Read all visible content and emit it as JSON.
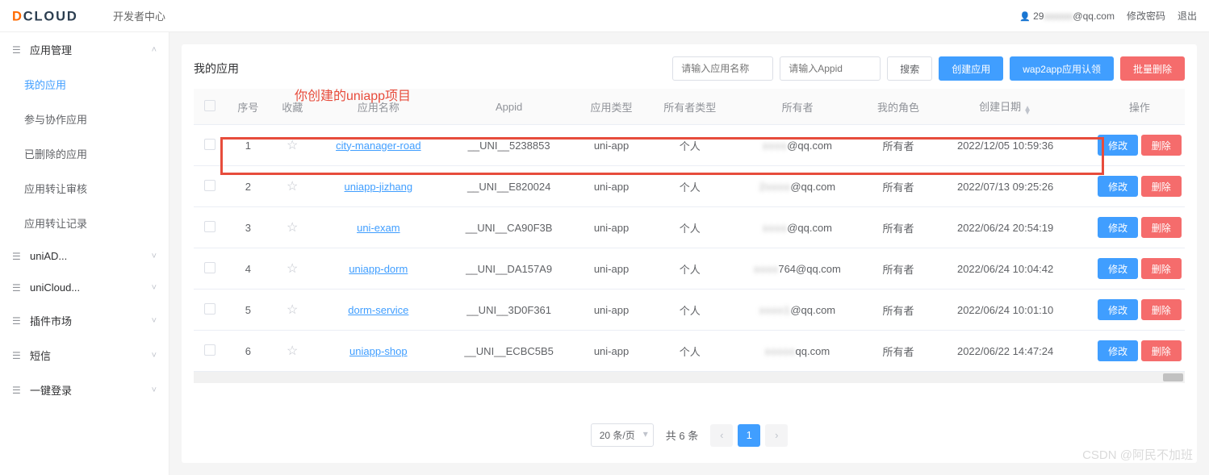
{
  "header": {
    "logo_text": "DCLOUD",
    "center_title": "开发者中心",
    "user_prefix": "29",
    "user_suffix": "@qq.com",
    "change_pwd": "修改密码",
    "logout": "退出"
  },
  "sidebar": {
    "groups": [
      {
        "label": "应用管理",
        "expanded": true,
        "items": [
          {
            "label": "我的应用",
            "active": true
          },
          {
            "label": "参与协作应用"
          },
          {
            "label": "已删除的应用"
          },
          {
            "label": "应用转让审核"
          },
          {
            "label": "应用转让记录"
          }
        ]
      },
      {
        "label": "uniAD..."
      },
      {
        "label": "uniCloud..."
      },
      {
        "label": "插件市场"
      },
      {
        "label": "短信"
      },
      {
        "label": "一键登录"
      }
    ]
  },
  "page": {
    "title": "我的应用",
    "annotation": "你创建的uniapp项目",
    "search_name_placeholder": "请输入应用名称",
    "search_appid_placeholder": "请输入Appid",
    "btn_search": "搜索",
    "btn_create": "创建应用",
    "btn_wap2app": "wap2app应用认领",
    "btn_batch_delete": "批量删除"
  },
  "table": {
    "headers": {
      "index": "序号",
      "fav": "收藏",
      "name": "应用名称",
      "appid": "Appid",
      "type": "应用类型",
      "owner_type": "所有者类型",
      "owner": "所有者",
      "role": "我的角色",
      "created": "创建日期",
      "ops": "操作"
    },
    "btn_edit": "修改",
    "btn_delete": "删除",
    "rows": [
      {
        "idx": "1",
        "name": "city-manager-road",
        "appid": "__UNI__5238853",
        "type": "uni-app",
        "owner_type": "个人",
        "owner_blur": "xxxx",
        "owner_suffix": "@qq.com",
        "role": "所有者",
        "created": "2022/12/05 10:59:36",
        "highlight": true
      },
      {
        "idx": "2",
        "name": "uniapp-jizhang",
        "appid": "__UNI__E820024",
        "type": "uni-app",
        "owner_type": "个人",
        "owner_blur": "2xxxx",
        "owner_suffix": "@qq.com",
        "role": "所有者",
        "created": "2022/07/13 09:25:26"
      },
      {
        "idx": "3",
        "name": "uni-exam",
        "appid": "__UNI__CA90F3B",
        "type": "uni-app",
        "owner_type": "个人",
        "owner_blur": "xxxx",
        "owner_suffix": "@qq.com",
        "role": "所有者",
        "created": "2022/06/24 20:54:19"
      },
      {
        "idx": "4",
        "name": "uniapp-dorm",
        "appid": "__UNI__DA157A9",
        "type": "uni-app",
        "owner_type": "个人",
        "owner_blur": "xxxx",
        "owner_suffix": "764@qq.com",
        "role": "所有者",
        "created": "2022/06/24 10:04:42"
      },
      {
        "idx": "5",
        "name": "dorm-service",
        "appid": "__UNI__3D0F361",
        "type": "uni-app",
        "owner_type": "个人",
        "owner_blur": "xxxx1",
        "owner_suffix": "@qq.com",
        "role": "所有者",
        "created": "2022/06/24 10:01:10"
      },
      {
        "idx": "6",
        "name": "uniapp-shop",
        "appid": "__UNI__ECBC5B5",
        "type": "uni-app",
        "owner_type": "个人",
        "owner_blur": "xxxxx",
        "owner_suffix": "qq.com",
        "role": "所有者",
        "created": "2022/06/22 14:47:24"
      }
    ]
  },
  "pagination": {
    "page_size": "20 条/页",
    "total_text": "共 6 条",
    "current": "1"
  },
  "watermark": "CSDN @阿民不加班"
}
